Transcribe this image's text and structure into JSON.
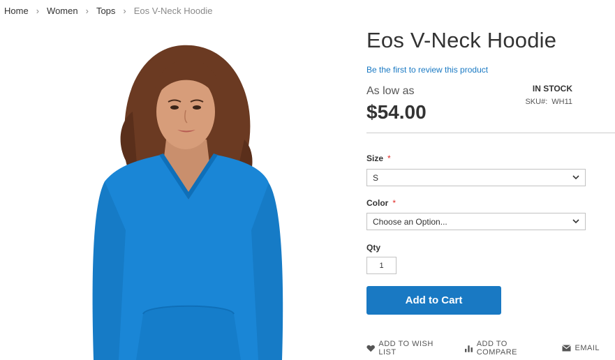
{
  "breadcrumbs": {
    "items": [
      "Home",
      "Women",
      "Tops"
    ],
    "current": "Eos V-Neck Hoodie",
    "separator": "›"
  },
  "product": {
    "title": "Eos V-Neck Hoodie",
    "review_link": "Be the first to review this product",
    "price_prefix": "As low as",
    "price": "$54.00",
    "stock": "IN STOCK",
    "sku_label": "SKU#:",
    "sku_value": "WH11",
    "image_icon": "product-photo"
  },
  "options": {
    "size": {
      "label": "Size",
      "required_mark": "*",
      "value": "S"
    },
    "color": {
      "label": "Color",
      "required_mark": "*",
      "value": "Choose an Option..."
    }
  },
  "qty": {
    "label": "Qty",
    "value": "1"
  },
  "buttons": {
    "add_to_cart": "Add to Cart"
  },
  "actions": {
    "wishlist": "ADD TO WISH LIST",
    "compare": "ADD TO COMPARE",
    "email": "EMAIL"
  },
  "colors": {
    "accent": "#1979c3",
    "required": "#e02b27",
    "garment": "#1a86d6"
  }
}
